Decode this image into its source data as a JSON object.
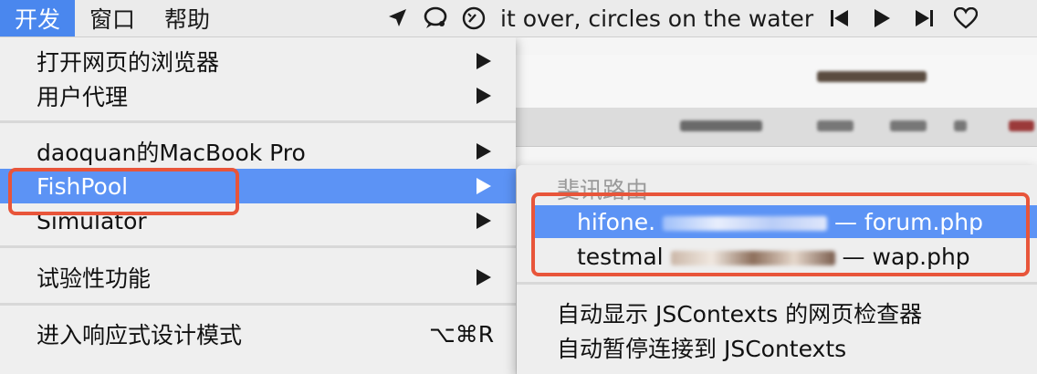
{
  "menubar": {
    "items": [
      {
        "label": "开发",
        "active": true
      },
      {
        "label": "窗口",
        "active": false
      },
      {
        "label": "帮助",
        "active": false
      }
    ],
    "now_playing": "it over, circles on the water",
    "status_icons": [
      "location-arrow-icon",
      "chat-bubble-icon",
      "speedometer-icon"
    ],
    "media_icons": [
      "previous-track-icon",
      "play-icon",
      "next-track-icon",
      "heart-icon"
    ]
  },
  "dropdown": {
    "items": [
      {
        "label": "打开网页的浏览器",
        "submenu": true
      },
      {
        "label": "用户代理",
        "submenu": true
      },
      {
        "label": "daoquan的MacBook Pro",
        "submenu": true
      },
      {
        "label": "FishPool",
        "submenu": true,
        "highlighted": true
      },
      {
        "label": "Simulator",
        "submenu": true
      },
      {
        "label": "试验性功能",
        "submenu": true
      },
      {
        "label": "进入响应式设计模式",
        "shortcut": "⌥⌘R"
      }
    ]
  },
  "submenu": {
    "header": "斐讯路由",
    "pages": [
      {
        "host_prefix": "hifone.",
        "page": "— forum.php",
        "highlighted": true
      },
      {
        "host_prefix": "testmal",
        "page": "— wap.php",
        "highlighted": false
      }
    ],
    "options": [
      "自动显示 JSContexts 的网页检查器",
      "自动暂停连接到 JSContexts"
    ]
  },
  "colors": {
    "highlight": "#5c93f5",
    "annotation": "#e8553a",
    "menu_bg": "#efefef"
  }
}
